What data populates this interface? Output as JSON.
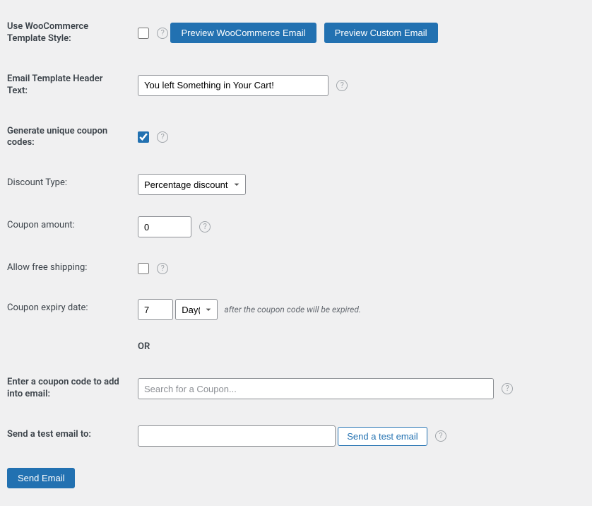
{
  "rows": {
    "use_template": {
      "label": "Use WooCommerce Template Style:",
      "checked": false,
      "btn_preview_woo": "Preview WooCommerce Email",
      "btn_preview_custom": "Preview Custom Email"
    },
    "header_text": {
      "label": "Email Template Header Text:",
      "value": "You left Something in Your Cart!"
    },
    "generate_coupon": {
      "label": "Generate unique coupon codes:",
      "checked": true
    },
    "discount_type": {
      "label": "Discount Type:",
      "selected": "Percentage discount"
    },
    "coupon_amount": {
      "label": "Coupon amount:",
      "value": "0"
    },
    "free_shipping": {
      "label": "Allow free shipping:",
      "checked": false
    },
    "expiry": {
      "label": "Coupon expiry date:",
      "value": "7",
      "unit": "Day(s)",
      "hint": "after the coupon code will be expired."
    },
    "or": "OR",
    "coupon_search": {
      "label": "Enter a coupon code to add into email:",
      "placeholder": "Search for a Coupon..."
    },
    "test_email": {
      "label": "Send a test email to:",
      "value": "",
      "btn": "Send a test email"
    },
    "submit": {
      "btn": "Send Email"
    }
  }
}
